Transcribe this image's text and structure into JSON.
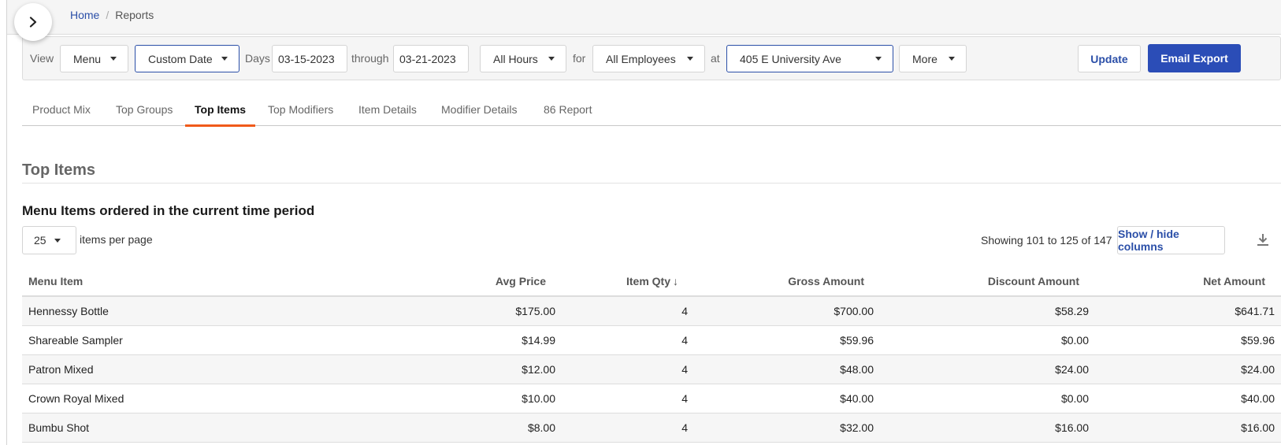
{
  "breadcrumb": {
    "home": "Home",
    "separator": "/",
    "current": "Reports"
  },
  "filters": {
    "view_label": "View",
    "view_value": "Menu",
    "date_range_value": "Custom Date",
    "days_label": "Days",
    "start_date": "03-15-2023",
    "through_label": "through",
    "end_date": "03-21-2023",
    "hours_value": "All Hours",
    "for_label": "for",
    "employees_value": "All Employees",
    "at_label": "at",
    "location_value": "405 E University Ave",
    "more_label": "More",
    "update_label": "Update",
    "email_export_label": "Email Export"
  },
  "tabs": [
    {
      "label": "Product Mix"
    },
    {
      "label": "Top Groups"
    },
    {
      "label": "Top Items",
      "active": true
    },
    {
      "label": "Top Modifiers"
    },
    {
      "label": "Item Details"
    },
    {
      "label": "Modifier Details"
    },
    {
      "label": "86 Report"
    }
  ],
  "section": {
    "title": "Top Items",
    "subtitle": "Menu Items ordered in the current time period"
  },
  "pagination": {
    "per_page": "25",
    "per_page_label": "items per page",
    "showing": "Showing 101 to 125 of 147",
    "show_hide_label": "Show / hide columns"
  },
  "icons": {
    "expand": "chevron-right-icon",
    "caret": "caret-down-icon",
    "sort": "arrow-down-icon",
    "download": "download-icon"
  },
  "colors": {
    "primary": "#2b4db7",
    "link": "#2b4fa8",
    "active_tab_underline": "#f05a1a"
  },
  "table": {
    "columns": [
      "Menu Item",
      "Avg Price",
      "Item Qty",
      "Gross Amount",
      "Discount Amount",
      "Net Amount"
    ],
    "sort_arrow": "↓",
    "rows": [
      [
        "Hennessy Bottle",
        "$175.00",
        "4",
        "$700.00",
        "$58.29",
        "$641.71"
      ],
      [
        "Shareable Sampler",
        "$14.99",
        "4",
        "$59.96",
        "$0.00",
        "$59.96"
      ],
      [
        "Patron Mixed",
        "$12.00",
        "4",
        "$48.00",
        "$24.00",
        "$24.00"
      ],
      [
        "Crown Royal Mixed",
        "$10.00",
        "4",
        "$40.00",
        "$0.00",
        "$40.00"
      ],
      [
        "Bumbu Shot",
        "$8.00",
        "4",
        "$32.00",
        "$16.00",
        "$16.00"
      ]
    ]
  }
}
